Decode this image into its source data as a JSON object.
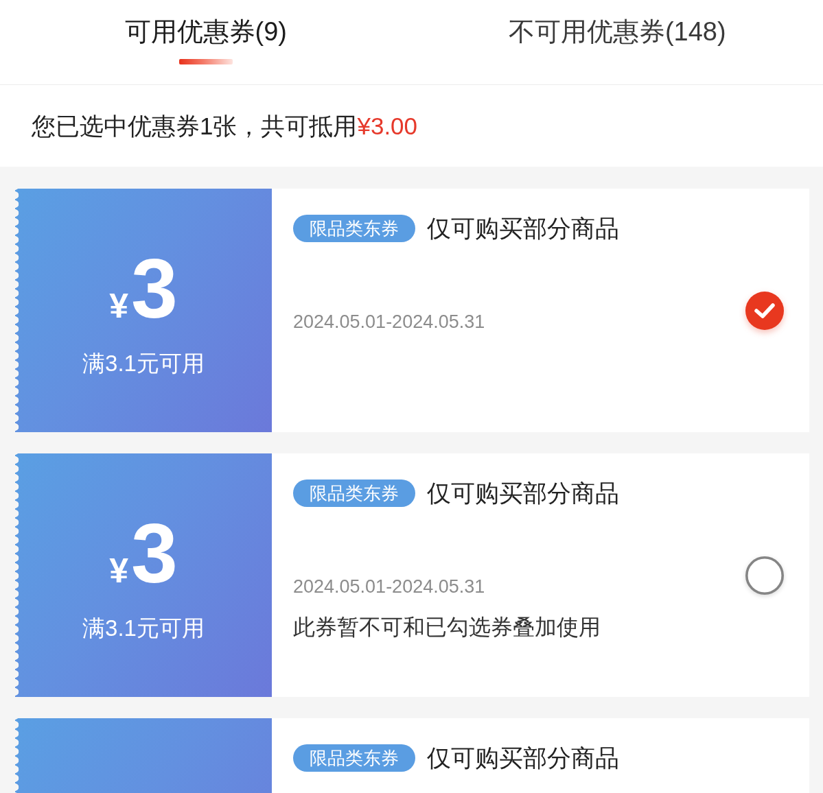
{
  "tabs": [
    {
      "label": "可用优惠券(9)",
      "selected": true
    },
    {
      "label": "不可用优惠券(148)",
      "selected": false
    }
  ],
  "summary": {
    "text": "您已选中优惠券1张，共可抵用",
    "amount": "¥3.00"
  },
  "coupons": [
    {
      "currency": "¥",
      "amount": "3",
      "condition": "满3.1元可用",
      "tag": "限品类东券",
      "title": "仅可购买部分商品",
      "validity": "2024.05.01-2024.05.31",
      "selected": true
    },
    {
      "currency": "¥",
      "amount": "3",
      "condition": "满3.1元可用",
      "tag": "限品类东券",
      "title": "仅可购买部分商品",
      "validity": "2024.05.01-2024.05.31",
      "note": "此券暂不可和已勾选券叠加使用",
      "selected": false
    },
    {
      "tag": "限品类东券",
      "title": "仅可购买部分商品"
    }
  ]
}
